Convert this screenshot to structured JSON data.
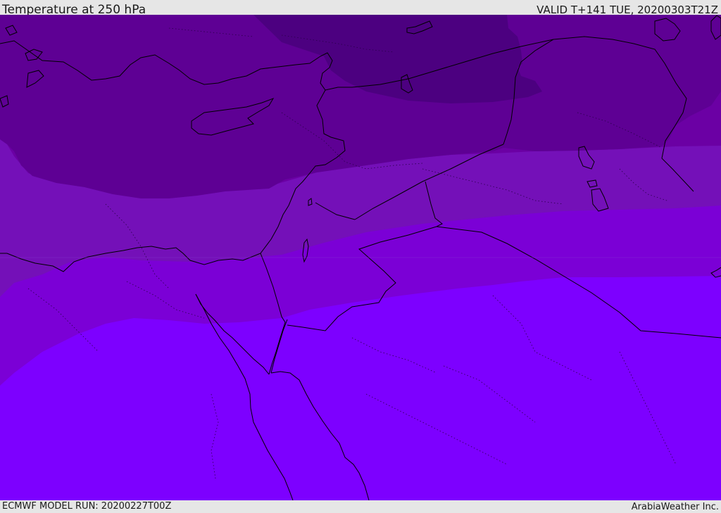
{
  "header": {
    "title": "Temperature at 250 hPa",
    "valid": "VALID T+141 TUE, 20200303T21Z"
  },
  "footer": {
    "model_run": "ECMWF MODEL RUN: 20200227T00Z",
    "credit": "ArabiaWeather Inc."
  },
  "colors": {
    "background_bar": "#e6e6e6",
    "band_coldest": "#4c0080",
    "band_cold": "#5e0094",
    "band_mid_cold": "#6b00a4",
    "band_mid": "#7410b8",
    "band_mid_warm": "#7b00d6",
    "band_warm": "#7d00ff",
    "coastline": "#000000"
  }
}
